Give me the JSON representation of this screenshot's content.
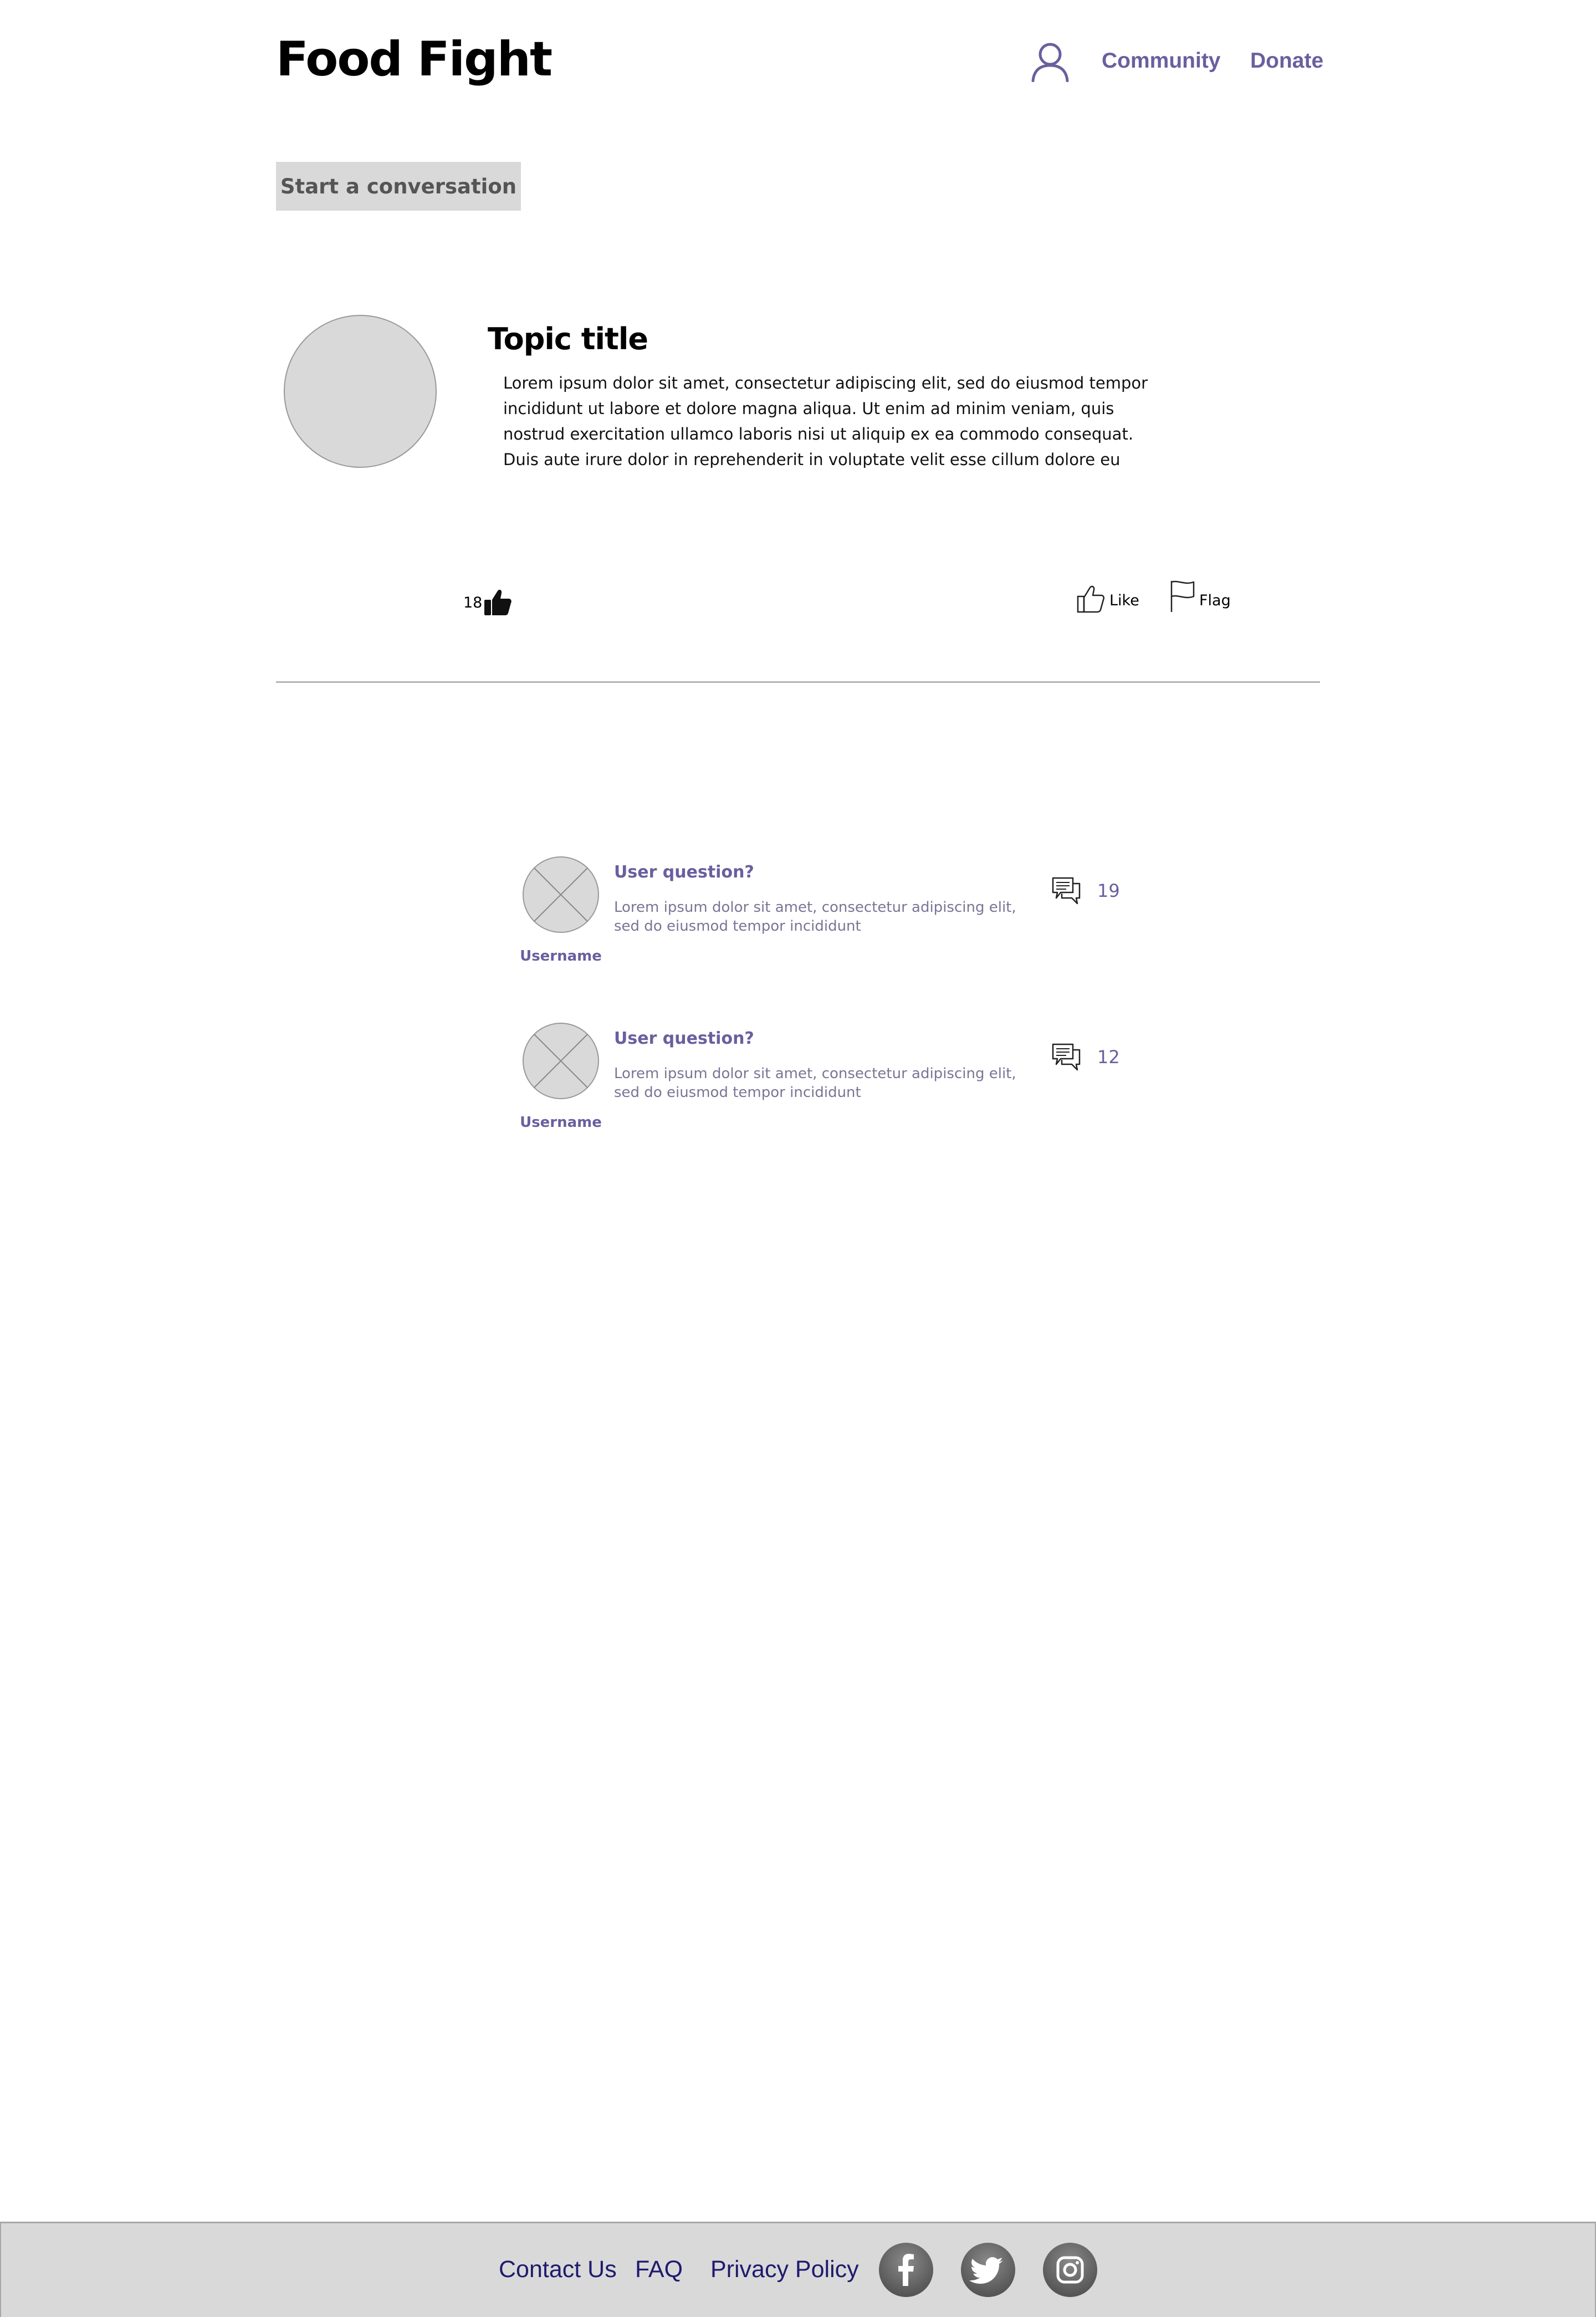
{
  "header": {
    "logo": "Food Fight",
    "nav": {
      "community": "Community",
      "donate": "Donate"
    },
    "user_icon": "user-icon"
  },
  "actions": {
    "start_conversation": "Start a conversation"
  },
  "topic": {
    "title": "Topic title",
    "body": "Lorem ipsum dolor sit amet, consectetur adipiscing elit, sed do eiusmod tempor incididunt ut labore et dolore magna aliqua. Ut enim ad minim veniam, quis nostrud exercitation ullamco laboris nisi ut aliquip ex ea commodo consequat. Duis aute irure dolor in reprehenderit in voluptate velit esse cillum dolore eu fugiat nulla pariatur",
    "like_count": "18",
    "like_label": "Like",
    "flag_label": "Flag"
  },
  "questions": [
    {
      "title": "User question?",
      "body": "Lorem ipsum dolor sit amet, consectetur adipiscing elit, sed do eiusmod tempor incididunt",
      "username": "Username",
      "comment_count": "19"
    },
    {
      "title": "User question?",
      "body": "Lorem ipsum dolor sit amet, consectetur adipiscing elit, sed do eiusmod tempor incididunt",
      "username": "Username",
      "comment_count": "12"
    }
  ],
  "footer": {
    "contact": "Contact Us",
    "faq": "FAQ",
    "privacy": "Privacy Policy",
    "social": [
      "facebook-icon",
      "twitter-icon",
      "instagram-icon"
    ]
  },
  "colors": {
    "accent": "#6a5f9e",
    "footer_link": "#1f1a6e",
    "placeholder_gray": "#d9d9d9"
  }
}
